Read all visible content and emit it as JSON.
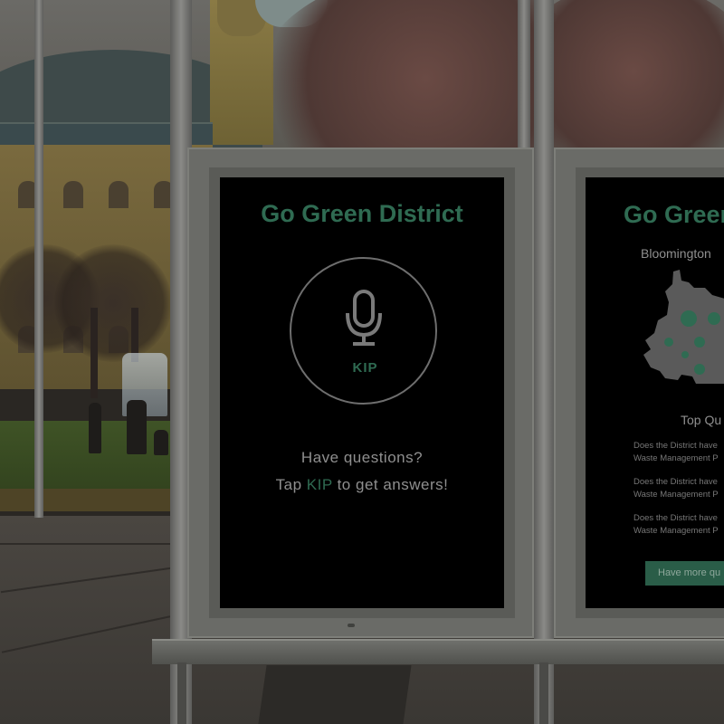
{
  "left_poster": {
    "title": "Go Green District",
    "assistant_name": "KIP",
    "line1": "Have questions?",
    "line2_prefix": "Tap ",
    "line2_highlight": "KIP",
    "line2_suffix": " to get answers!"
  },
  "right_poster": {
    "title": "Go Green",
    "subtitle": "Bloomington",
    "section_heading": "Top Qu",
    "questions": [
      {
        "line1": "Does the District have",
        "line2": "Waste Management P"
      },
      {
        "line1": "Does the District have",
        "line2": "Waste Management P"
      },
      {
        "line1": "Does the District have",
        "line2": "Waste Management P"
      }
    ],
    "button_label": "Have more qu"
  },
  "icons": {
    "microphone": "microphone-icon",
    "map": "district-map-icon"
  },
  "colors": {
    "accent": "#2f6b52",
    "text_gray": "#8f8f8f",
    "screen_bg": "#000000",
    "button_bg": "#2a5d48"
  }
}
